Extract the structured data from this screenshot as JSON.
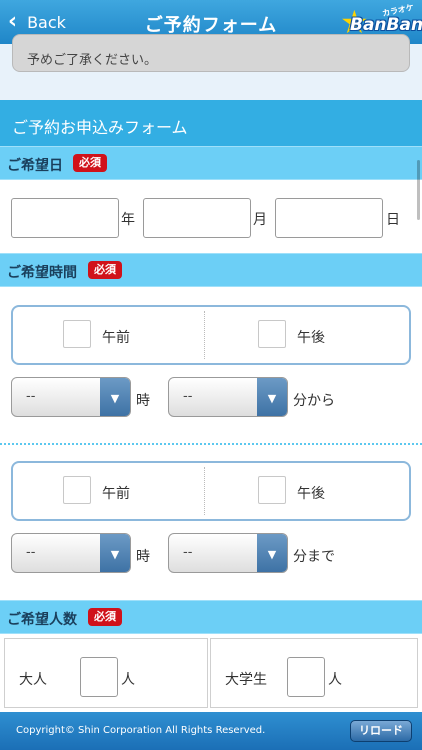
{
  "navbar": {
    "back_label": "Back",
    "title": "ご予約フォーム",
    "logo_text": "BanBan",
    "logo_kana": "カラオケ"
  },
  "notice": {
    "text": "予めご了承ください。"
  },
  "form": {
    "header": "ご予約お申込みフォーム",
    "required_badge": "必須",
    "date_section": {
      "label": "ご希望日",
      "year_unit": "年",
      "month_unit": "月",
      "day_unit": "日"
    },
    "time_section": {
      "label": "ご希望時間",
      "am_label": "午前",
      "pm_label": "午後",
      "start": {
        "hour_value": "--",
        "hour_unit": "時",
        "minute_value": "--",
        "minute_unit": "分から"
      },
      "end": {
        "hour_value": "--",
        "hour_unit": "時",
        "minute_value": "--",
        "minute_unit": "分まで"
      }
    },
    "people_section": {
      "label": "ご希望人数",
      "adult_label": "大人",
      "adult_unit": "人",
      "student_label": "大学生",
      "student_unit": "人"
    }
  },
  "footer": {
    "copyright": "Copyright© Shin Corporation All Rights Reserved.",
    "reload_label": "リロード"
  },
  "colors": {
    "nav": "#1f86c8",
    "section_head": "#6ccff6",
    "form_header": "#33aee3",
    "badge": "#d0121a"
  }
}
